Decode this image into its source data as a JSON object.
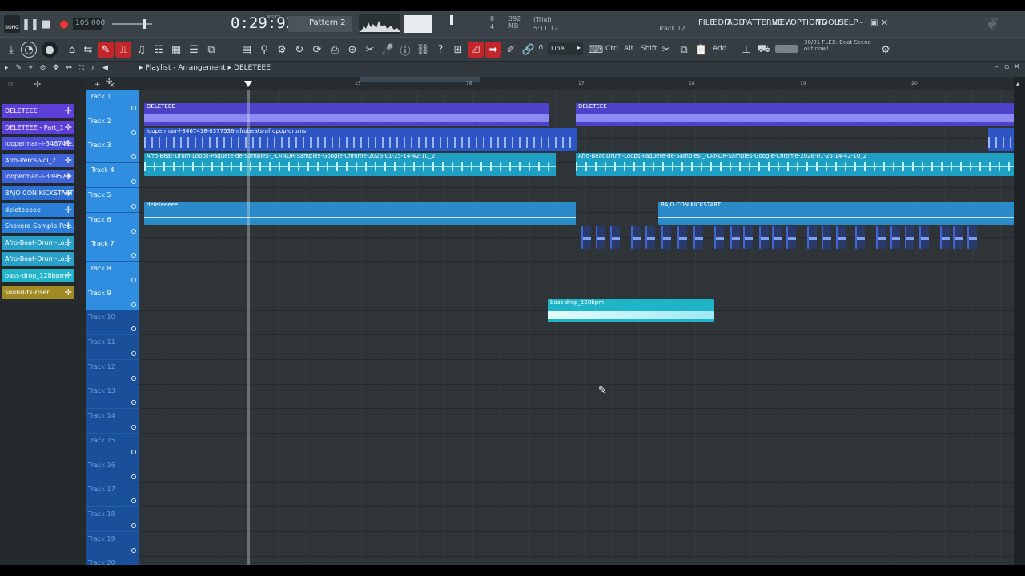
{
  "transport": {
    "mode_label": "SONG",
    "tempo": "105.000",
    "time": "0:29:92",
    "time_unit": "M:S:CS",
    "pattern": "Pattern 2",
    "cpu_top": "8",
    "cpu_bottom": "4",
    "mem": "392 MB",
    "trial": "(Trial)",
    "version": "5:11:12",
    "hint_track": "Track 12"
  },
  "menu": {
    "file": "FILE",
    "edit": "EDIT",
    "add": "ADD",
    "patterns": "PATTERNS",
    "view": "VIEW",
    "options": "OPTIONS",
    "tools": "TOOLS",
    "help": "HELP"
  },
  "toolbar": {
    "snap": "Line",
    "ctrl": "Ctrl",
    "alt": "Alt",
    "shift": "Shift",
    "add": "Add",
    "news_date": "30/01",
    "news_text": "FLEX: Beat Scene out now!"
  },
  "playlist": {
    "title": "Playlist - Arrangement",
    "arrangement": "DELETEEE",
    "bar_15": "15",
    "bar_16": "16",
    "bar_17": "17",
    "bar_18": "18",
    "bar_19": "19",
    "bar_20": "20"
  },
  "browser": {
    "items": [
      {
        "label": "DELETEEE",
        "color": "#5b3fd6"
      },
      {
        "label": "DELETEEE - Part_1",
        "color": "#5b3fd6"
      },
      {
        "label": "looperman-l-346741..",
        "color": "#4a4fd8"
      },
      {
        "label": "Afro-Percs-vol_2",
        "color": "#3f63d8"
      },
      {
        "label": "looperman-l-339573..",
        "color": "#3f63d8"
      },
      {
        "label": "BAJO CON KICKSTART",
        "color": "#2c6fd0"
      },
      {
        "label": "deleteeeee",
        "color": "#2a7ed8"
      },
      {
        "label": "Shekere-Sample-Pac..",
        "color": "#2a7ed8"
      },
      {
        "label": "Afro-Beat-Drum-Lo..",
        "color": "#2aa0c8"
      },
      {
        "label": "Afro-Beat-Drum-Lo..",
        "color": "#2aa0c8"
      },
      {
        "label": "bass-drop_128bpm",
        "color": "#22b4c8"
      },
      {
        "label": "sound-fx-riser",
        "color": "#a08a24"
      }
    ]
  },
  "tracks": [
    "Track 1",
    "Track 2",
    "Track 3",
    "Track 4",
    "Track 5",
    "Track 6",
    "Track 7",
    "Track 8",
    "Track 9",
    "Track 10",
    "Track 11",
    "Track 12",
    "Track 13",
    "Track 14",
    "Track 15",
    "Track 16",
    "Track 17",
    "Track 18",
    "Track 19",
    "Track 20"
  ],
  "clips": {
    "t1a": "DELETEEE",
    "t1b": "DELETEEE",
    "t2": "looperman-l-3467418-0377536-afrobeats-afropop-drums",
    "t3a": "Afro-Beat-Drum-Loops-Paquete-de-Samples-_-LANDR-Samples-Google-Chrome-2026-01-25-14-42-10_2",
    "t3b": "Afro-Beat-Drum-Loops-Paquete-de-Samples-_-LANDR-Samples-Google-Chrome-2026-01-25-14-42-10_2",
    "t5a": "deleteeeee",
    "t5b": "BAJO CON KICKSTART",
    "t9": "bass-drop_128bpm"
  },
  "colors": {
    "track_active": "#2f8ee0",
    "track_dim": "#1a4f9a",
    "accent_red": "#c0262a",
    "clip_purple": "#4a42c8",
    "clip_blue": "#2e58c6",
    "clip_cyan": "#1fa8c4",
    "clip_teal": "#2a8bc8"
  }
}
